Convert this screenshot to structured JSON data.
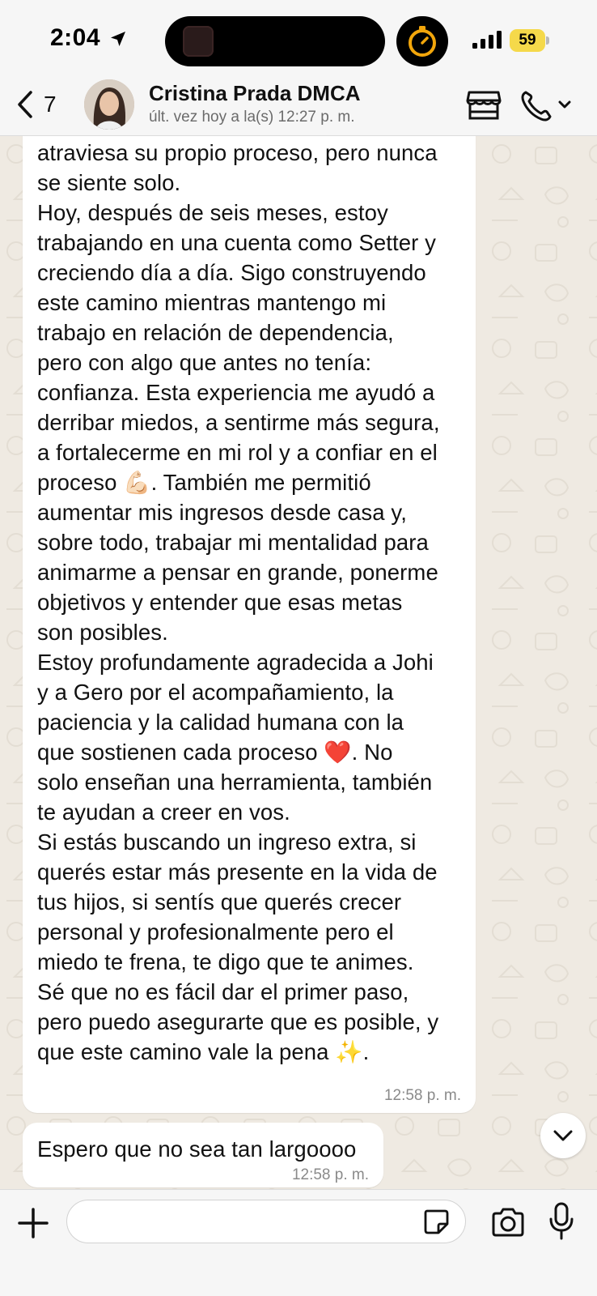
{
  "status_bar": {
    "time": "2:04",
    "battery": "59",
    "icons": [
      "location-arrow-icon",
      "timer-icon",
      "cellular-signal-icon",
      "battery-icon"
    ]
  },
  "header": {
    "back_count": "7",
    "contact_name": "Cristina Prada DMCA",
    "last_seen": "últ. vez hoy a la(s) 12:27 p. m.",
    "icons": [
      "chevron-left-icon",
      "store-icon",
      "phone-icon",
      "chevron-down-icon"
    ]
  },
  "messages": [
    {
      "text": "atraviesa su propio proceso, pero nunca\nse siente solo.\nHoy, después de seis meses, estoy\ntrabajando en una cuenta como Setter y\ncreciendo día a día. Sigo construyendo\neste camino mientras mantengo mi\ntrabajo en relación de dependencia,\npero con algo que antes no tenía:\nconfianza. Esta experiencia me ayudó a\nderribar miedos, a sentirme más segura,\na fortalecerme en mi rol y a confiar en el\nproceso 💪🏻. También me permitió\naumentar mis ingresos desde casa y,\nsobre todo, trabajar mi mentalidad para\nanimarme a pensar en grande, ponerme\nobjetivos y entender que esas metas\nson posibles.\nEstoy profundamente agradecida a Johi\ny a Gero por el acompañamiento, la\npaciencia y la calidad humana con la\nque sostienen cada proceso ❤️. No\nsolo enseñan una herramienta, también\nte ayudan a creer en vos.\nSi estás buscando un ingreso extra, si\nquerés estar más presente en la vida de\ntus hijos, si sentís que querés crecer\npersonal y profesionalmente pero el\nmiedo te frena, te digo que te animes.\nSé que no es fácil dar el primer paso,\npero puedo asegurarte que es posible, y\nque este camino vale la pena ✨.",
      "time": "12:58 p. m."
    },
    {
      "text": "Espero que no sea tan largoooo",
      "time": "12:58 p. m."
    }
  ],
  "input_bar": {
    "placeholder": "",
    "icons": [
      "plus-icon",
      "sticker-icon",
      "camera-icon",
      "microphone-icon"
    ]
  },
  "colors": {
    "background": "#efeae2",
    "bubble": "#ffffff",
    "bar": "#f6f6f6",
    "battery": "#f5d94a",
    "timer_accent": "#f2a60b"
  }
}
